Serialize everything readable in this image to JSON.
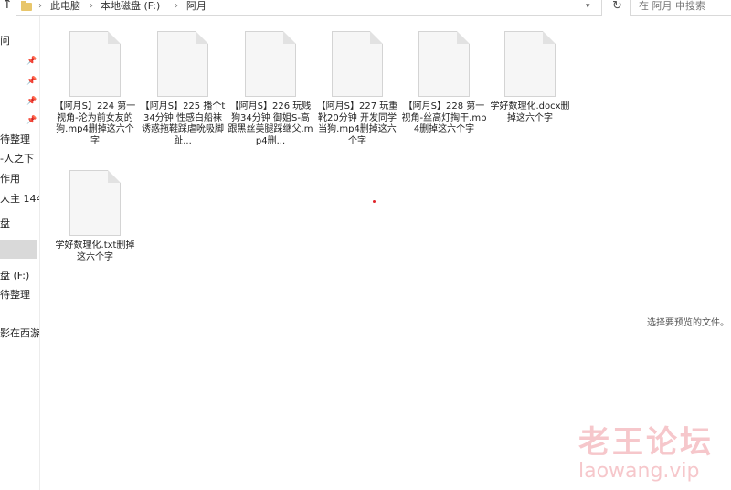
{
  "address": {
    "crumbs": [
      "此电脑",
      "本地磁盘 (F:)",
      "阿月"
    ],
    "search_placeholder": "在 阿月 中搜索"
  },
  "nav": {
    "items": [
      "问",
      "待整理",
      "-人之下",
      "作用",
      "人主 144-",
      "盘",
      "盘 (F:)",
      "待整理",
      "影在西游"
    ]
  },
  "files": [
    {
      "name": "【阿月S】224 第一视角-沦为前女友的狗.mp4删掉这六个字"
    },
    {
      "name": "【阿月S】225 播个t34分钟 性感白船袜诱惑拖鞋踩虐吮吸脚趾..."
    },
    {
      "name": "【阿月S】226 玩贱狗34分钟 御姐S-高跟黑丝美腿踩继父.mp4删..."
    },
    {
      "name": "【阿月S】227 玩重靴20分钟 开发同学当狗.mp4删掉这六个字"
    },
    {
      "name": "【阿月S】228 第一视角-丝高灯掏干.mp4删掉这六个字"
    },
    {
      "name": "学好数理化.docx删掉这六个字"
    },
    {
      "name": "学好数理化.txt删掉这六个字"
    }
  ],
  "preview_text": "选择要预览的文件。",
  "watermark": {
    "title": "老王论坛",
    "url": "laowang.vip"
  }
}
